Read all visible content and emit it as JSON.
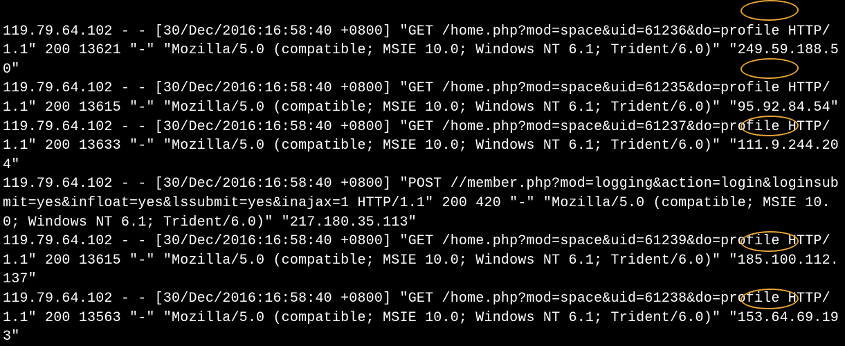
{
  "log": {
    "entries": [
      {
        "client_ip": "119.79.64.102",
        "ident": "-",
        "user": "-",
        "time": "[30/Dec/2016:16:58:40 +0800]",
        "request": "\"GET /home.php?mod=space&uid=61236&do=profile HTTP/1.1\"",
        "status": "200",
        "bytes": "13621",
        "referer": "\"-\"",
        "ua": "\"Mozilla/5.0 (compatible; MSIE 10.0; Windows NT 6.1; Trident/6.0)\"",
        "xff": "\"249.59.188.50\"",
        "highlight_uid": "61236"
      },
      {
        "client_ip": "119.79.64.102",
        "ident": "-",
        "user": "-",
        "time": "[30/Dec/2016:16:58:40 +0800]",
        "request": "\"GET /home.php?mod=space&uid=61235&do=profile HTTP/1.1\"",
        "status": "200",
        "bytes": "13615",
        "referer": "\"-\"",
        "ua": "\"Mozilla/5.0 (compatible; MSIE 10.0; Windows NT 6.1; Trident/6.0)\"",
        "xff": "\"95.92.84.54\"",
        "highlight_uid": "61235"
      },
      {
        "client_ip": "119.79.64.102",
        "ident": "-",
        "user": "-",
        "time": "[30/Dec/2016:16:58:40 +0800]",
        "request": "\"GET /home.php?mod=space&uid=61237&do=profile HTTP/1.1\"",
        "status": "200",
        "bytes": "13633",
        "referer": "\"-\"",
        "ua": "\"Mozilla/5.0 (compatible; MSIE 10.0; Windows NT 6.1; Trident/6.0)\"",
        "xff": "\"111.9.244.204\"",
        "highlight_uid": "61237"
      },
      {
        "client_ip": "119.79.64.102",
        "ident": "-",
        "user": "-",
        "time": "[30/Dec/2016:16:58:40 +0800]",
        "request": "\"POST //member.php?mod=logging&action=login&loginsubmit=yes&infloat=yes&lssubmit=yes&inajax=1 HTTP/1.1\"",
        "status": "200",
        "bytes": "420",
        "referer": "\"-\"",
        "ua": "\"Mozilla/5.0 (compatible; MSIE 10.0; Windows NT 6.1; Trident/6.0)\"",
        "xff": "\"217.180.35.113\"",
        "highlight_uid": null
      },
      {
        "client_ip": "119.79.64.102",
        "ident": "-",
        "user": "-",
        "time": "[30/Dec/2016:16:58:40 +0800]",
        "request": "\"GET /home.php?mod=space&uid=61239&do=profile HTTP/1.1\"",
        "status": "200",
        "bytes": "13615",
        "referer": "\"-\"",
        "ua": "\"Mozilla/5.0 (compatible; MSIE 10.0; Windows NT 6.1; Trident/6.0)\"",
        "xff": "\"185.100.112.137\"",
        "highlight_uid": "61239"
      },
      {
        "client_ip": "119.79.64.102",
        "ident": "-",
        "user": "-",
        "time": "[30/Dec/2016:16:58:40 +0800]",
        "request": "\"GET /home.php?mod=space&uid=61238&do=profile HTTP/1.1\"",
        "status": "200",
        "bytes": "13563",
        "referer": "\"-\"",
        "ua": "\"Mozilla/5.0 (compatible; MSIE 10.0; Windows NT 6.1; Trident/6.0)\"",
        "xff": "\"153.64.69.193\"",
        "highlight_uid": "61238"
      }
    ]
  },
  "annotation": {
    "shape": "ellipse",
    "color": "#e5a43a",
    "targets": [
      "61236",
      "61235",
      "61237",
      "61239",
      "61238"
    ]
  }
}
